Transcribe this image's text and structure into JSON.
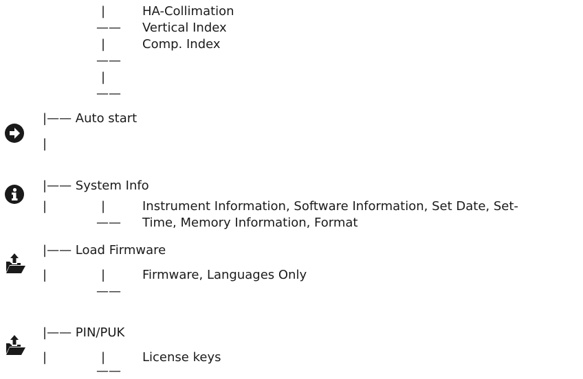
{
  "top_block": {
    "tree": {
      "pipe1": "|",
      "dash1": "——",
      "pipe2": "|",
      "dash2": "——",
      "pipe3": "|",
      "dash3": "——"
    },
    "items": [
      "HA-Collimation",
      "Vertical Index",
      "Comp. Index"
    ]
  },
  "sections": [
    {
      "icon": "arrow-circle-right-icon",
      "branch": "|—— Auto start",
      "pipe": "|"
    },
    {
      "icon": "info-circle-icon",
      "branch": "|—— System Info",
      "pipe": "|",
      "sub_pipe": "|",
      "sub_dash": "——",
      "sub_text_line1": "Instrument Information, Software Information, Set Date, Set-",
      "sub_text_line2": "Time, Memory Information, Format"
    },
    {
      "icon": "folder-upload-icon",
      "branch": "|—— Load Firmware",
      "pipe": "|",
      "sub_pipe": "|",
      "sub_dash": "——",
      "sub_text": "Firmware, Languages Only"
    },
    {
      "icon": "folder-upload-icon",
      "branch": "|—— PIN/PUK",
      "pipe": "|",
      "sub_pipe": "|",
      "sub_dash": "——",
      "sub_text": "License keys"
    }
  ]
}
